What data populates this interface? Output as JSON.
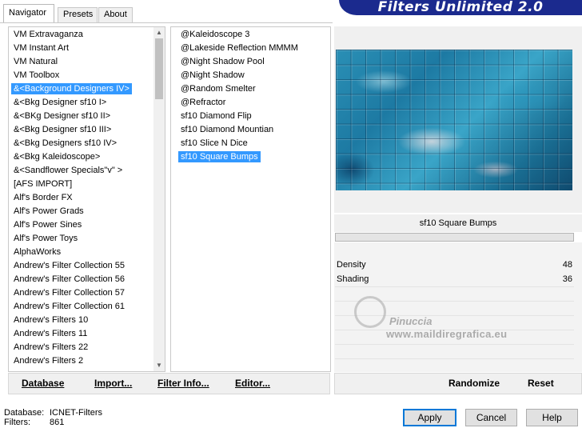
{
  "brand": {
    "title": "Filters Unlimited 2.0"
  },
  "tabs": [
    {
      "label": "Navigator",
      "active": true
    },
    {
      "label": "Presets",
      "active": false
    },
    {
      "label": "About",
      "active": false
    }
  ],
  "categories": {
    "items": [
      "VM Extravaganza",
      "VM Instant Art",
      "VM Natural",
      "VM Toolbox",
      "&<Background Designers IV>",
      "&<Bkg Designer sf10 I>",
      "&<BKg Designer sf10 II>",
      "&<Bkg Designer sf10 III>",
      "&<Bkg Designers sf10 IV>",
      "&<Bkg Kaleidoscope>",
      "&<Sandflower Specials\"v\" >",
      "[AFS IMPORT]",
      "Alf's Border FX",
      "Alf's Power Grads",
      "Alf's Power Sines",
      "Alf's Power Toys",
      "AlphaWorks",
      "Andrew's Filter Collection 55",
      "Andrew's Filter Collection 56",
      "Andrew's Filter Collection 57",
      "Andrew's Filter Collection 61",
      "Andrew's Filters 10",
      "Andrew's Filters 11",
      "Andrew's Filters 22",
      "Andrew's Filters 2"
    ],
    "selected_index": 4,
    "scroll_position": 0.18
  },
  "filters": {
    "items": [
      "@Kaleidoscope 3",
      "@Lakeside Reflection MMMM",
      "@Night Shadow Pool",
      "@Night Shadow",
      "@Random Smelter",
      "@Refractor",
      "sf10 Diamond Flip",
      "sf10 Diamond Mountian",
      "sf10 Slice N Dice",
      "sf10 Square Bumps"
    ],
    "selected_index": 9
  },
  "preview": {
    "filter_name": "sf10 Square Bumps"
  },
  "params": [
    {
      "label": "Density",
      "value": "48"
    },
    {
      "label": "Shading",
      "value": "36"
    }
  ],
  "watermark": {
    "name": "Pinuccia",
    "url": "www.maildiregrafica.eu"
  },
  "toolbar": {
    "database": "Database",
    "import": "Import...",
    "filter_info": "Filter Info...",
    "editor": "Editor...",
    "randomize": "Randomize",
    "reset": "Reset"
  },
  "status": {
    "database_label": "Database:",
    "database_value": "ICNET-Filters",
    "filters_label": "Filters:",
    "filters_value": "861"
  },
  "buttons": {
    "apply": "Apply",
    "cancel": "Cancel",
    "help": "Help"
  },
  "colors": {
    "brand_bg": "#1b2a8e",
    "selection": "#3399ff"
  }
}
